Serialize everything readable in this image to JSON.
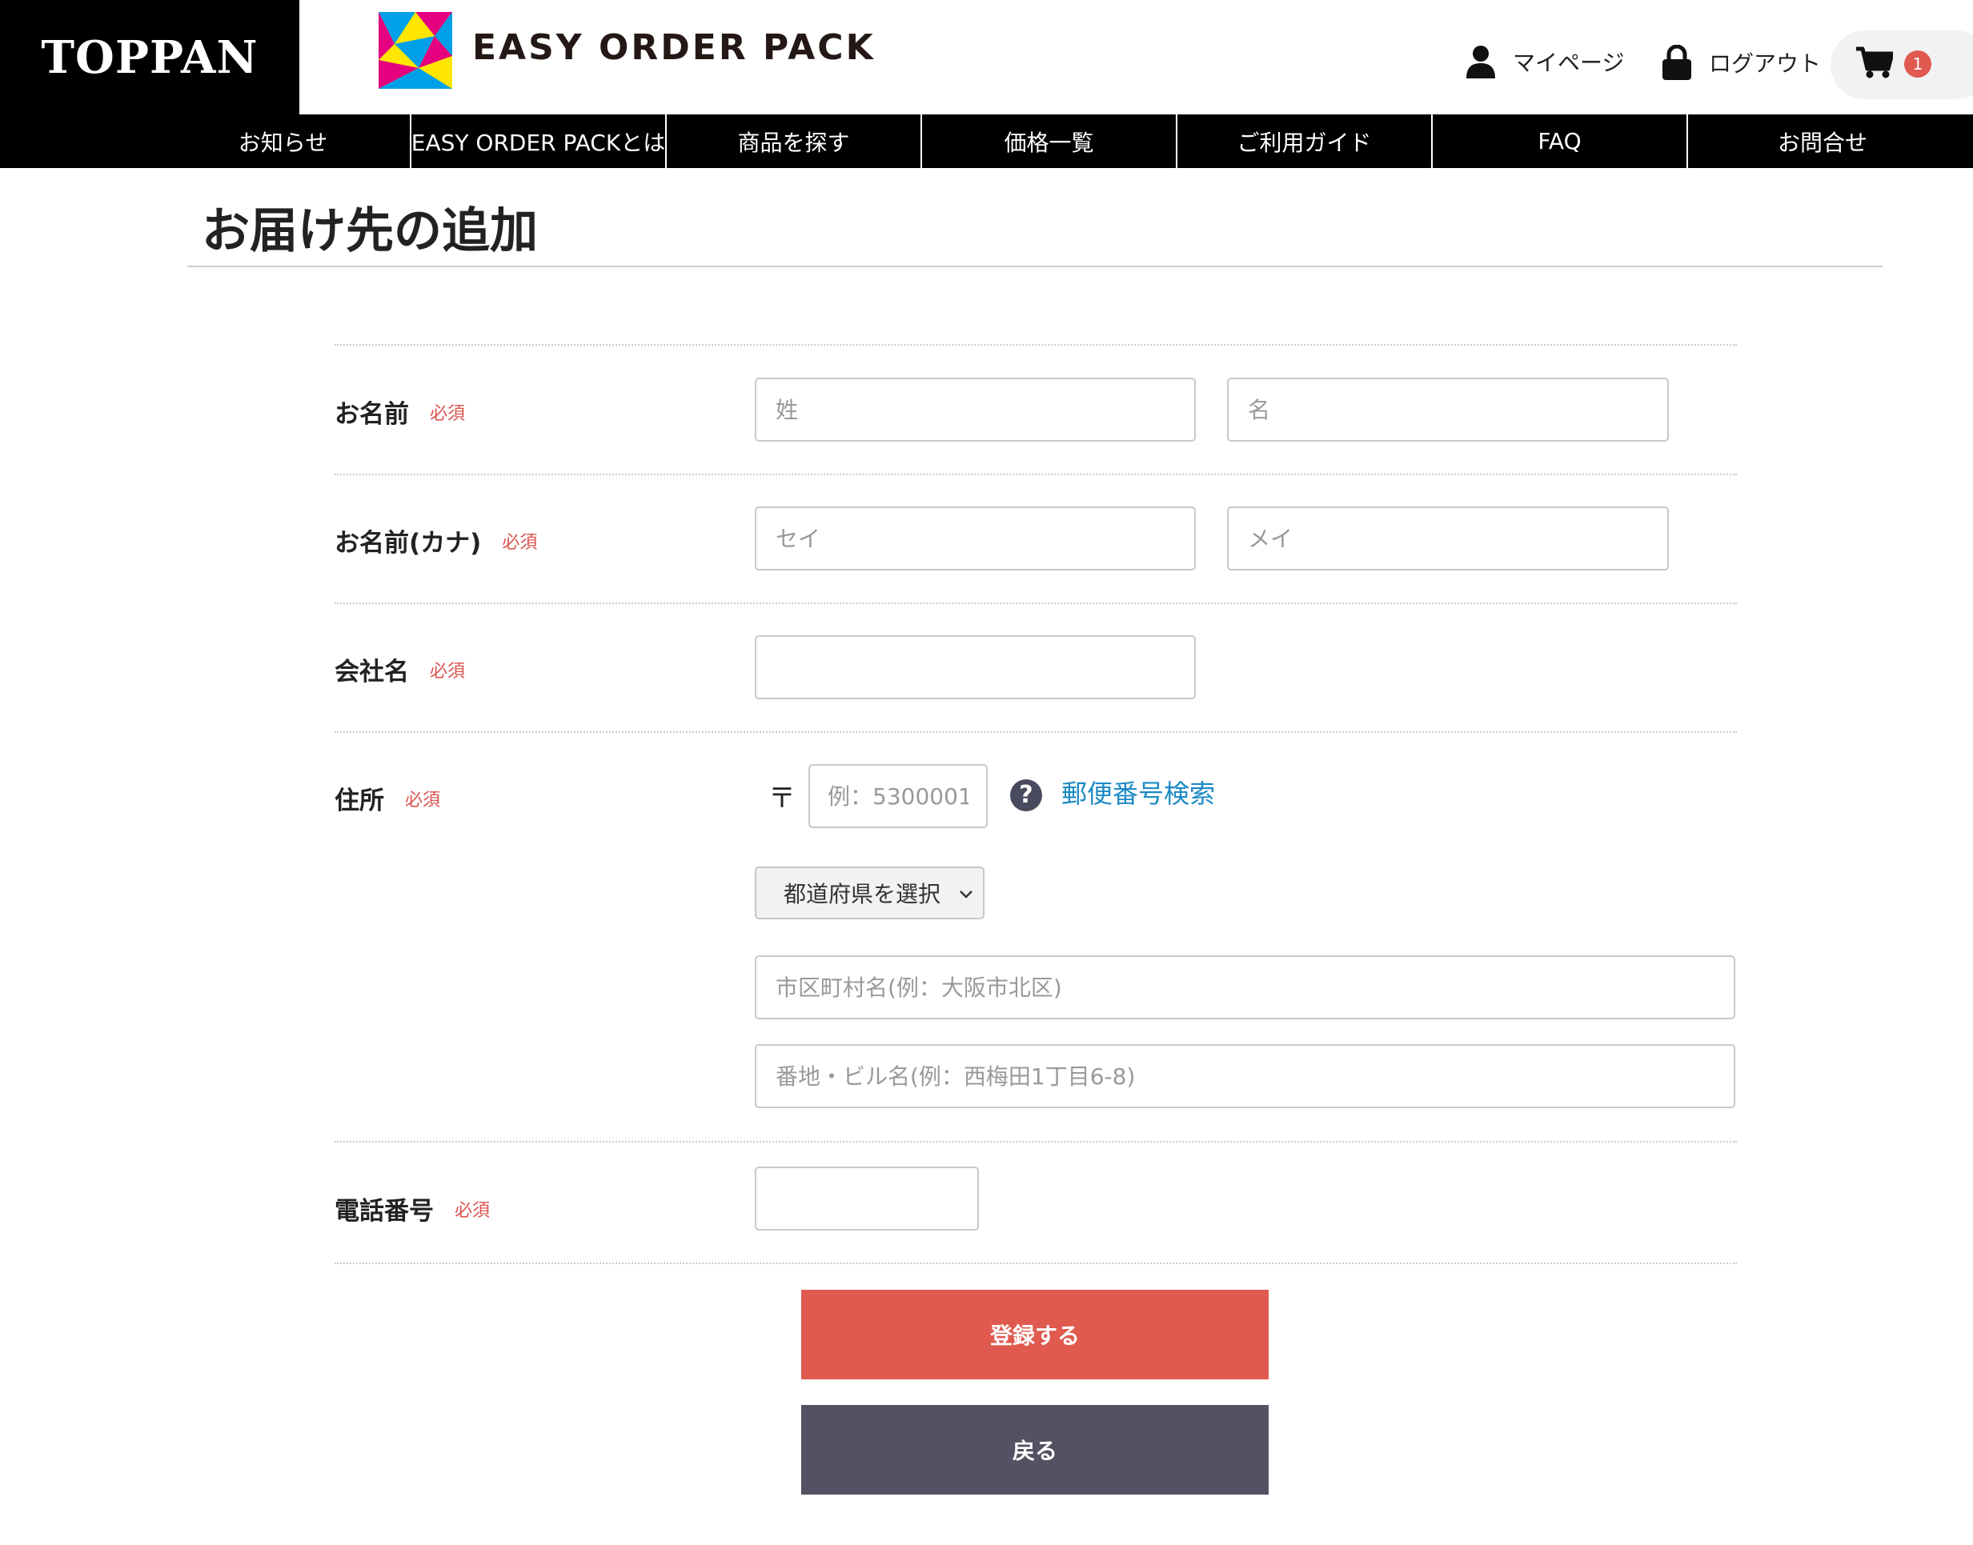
{
  "header": {
    "brand": "TOPPAN",
    "logo_text": "EASY ORDER PACK",
    "mypage_label": "マイページ",
    "logout_label": "ログアウト",
    "cart_count": "1"
  },
  "nav": {
    "items": [
      {
        "label": "お知らせ"
      },
      {
        "label": "EASY ORDER PACKとは"
      },
      {
        "label": "商品を探す"
      },
      {
        "label": "価格一覧"
      },
      {
        "label": "ご利用ガイド"
      },
      {
        "label": "FAQ"
      },
      {
        "label": "お問合せ"
      }
    ]
  },
  "page": {
    "title": "お届け先の追加"
  },
  "form": {
    "required_label": "必須",
    "name": {
      "label": "お名前",
      "last_placeholder": "姓",
      "first_placeholder": "名"
    },
    "kana": {
      "label": "お名前(カナ)",
      "last_placeholder": "セイ",
      "first_placeholder": "メイ"
    },
    "company": {
      "label": "会社名",
      "placeholder": ""
    },
    "address": {
      "label": "住所",
      "postal_mark": "〒",
      "postal_placeholder": "例：5300001",
      "postal_search_label": "郵便番号検索",
      "help_icon_glyph": "?",
      "prefecture_selected": "都道府県を選択",
      "city_placeholder": "市区町村名(例：大阪市北区)",
      "street_placeholder": "番地・ビル名(例：西梅田1丁目6-8)"
    },
    "phone": {
      "label": "電話番号",
      "placeholder": ""
    },
    "buttons": {
      "register_label": "登録する",
      "back_label": "戻る"
    }
  },
  "colors": {
    "accent_red": "#e05a4f",
    "button_dark": "#525263",
    "link_blue": "#1b8ac4",
    "required_red": "#d9534f",
    "nav_bg": "#000000"
  }
}
